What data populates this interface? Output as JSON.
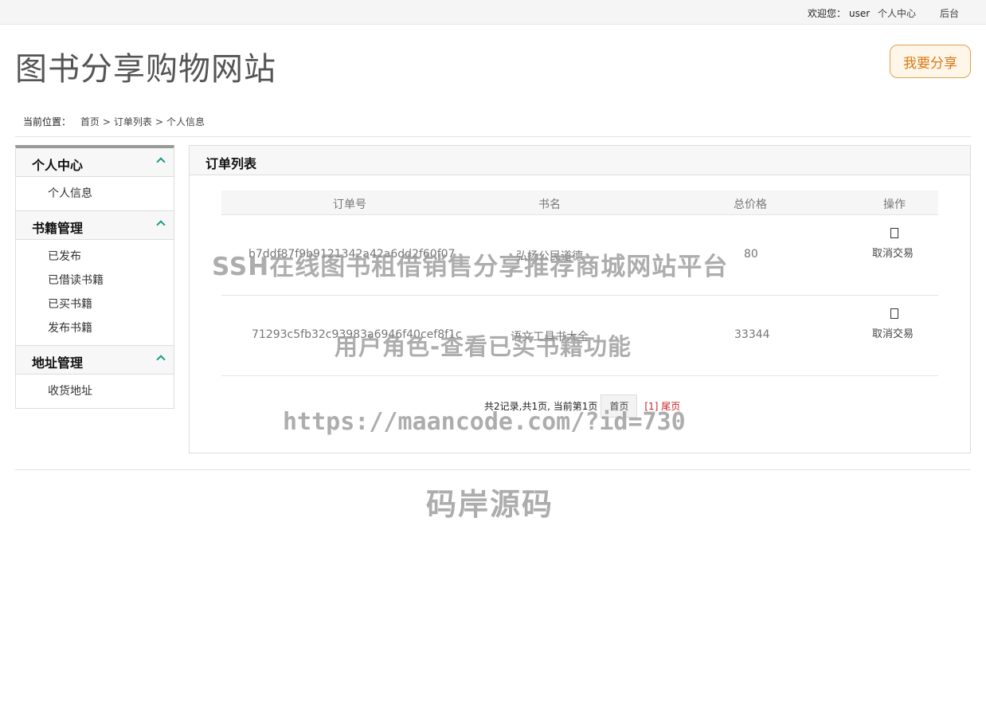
{
  "topbar": {
    "welcome_label": "欢迎您：",
    "username": "user",
    "personal_center": "个人中心",
    "admin": "后台"
  },
  "header": {
    "site_title": "图书分享购物网站",
    "share_button": "我要分享"
  },
  "breadcrumb": {
    "prefix": "当前位置：",
    "items": [
      "首页",
      "订单列表",
      "个人信息"
    ],
    "separator": ">"
  },
  "sidebar": {
    "sections": [
      {
        "title": "个人中心",
        "items": [
          "个人信息"
        ]
      },
      {
        "title": "书籍管理",
        "items": [
          "已发布",
          "已借读书籍",
          "已买书籍",
          "发布书籍"
        ]
      },
      {
        "title": "地址管理",
        "items": [
          "收货地址"
        ]
      }
    ]
  },
  "main": {
    "panel_title": "订单列表",
    "columns": [
      "订单号",
      "书名",
      "总价格",
      "操作"
    ],
    "rows": [
      {
        "order_no": "b7ddf87f9b9121342a42a6dd2f60f07",
        "book": "弘扬公民道德",
        "price": "80",
        "action": "取消交易"
      },
      {
        "order_no": "71293c5fb32c93983a6946f40cef8f1c",
        "book": "语文工具书大全",
        "price": "33344",
        "action": "取消交易"
      }
    ],
    "pager": {
      "summary": "共2记录,共1页, 当前第1页",
      "first": "首页",
      "last": "[1] 尾页"
    }
  },
  "watermarks": {
    "line1": "SSH在线图书租借销售分享推荐商城网站平台",
    "line2": "用户角色-查看已买书籍功能",
    "url": "https://maancode.com/?id=730",
    "brand": "码岸源码"
  },
  "colors": {
    "accent": "#1a9b8a",
    "share_border": "#e0a14e",
    "share_text": "#d97a13",
    "pager_last": "#cc2222"
  }
}
